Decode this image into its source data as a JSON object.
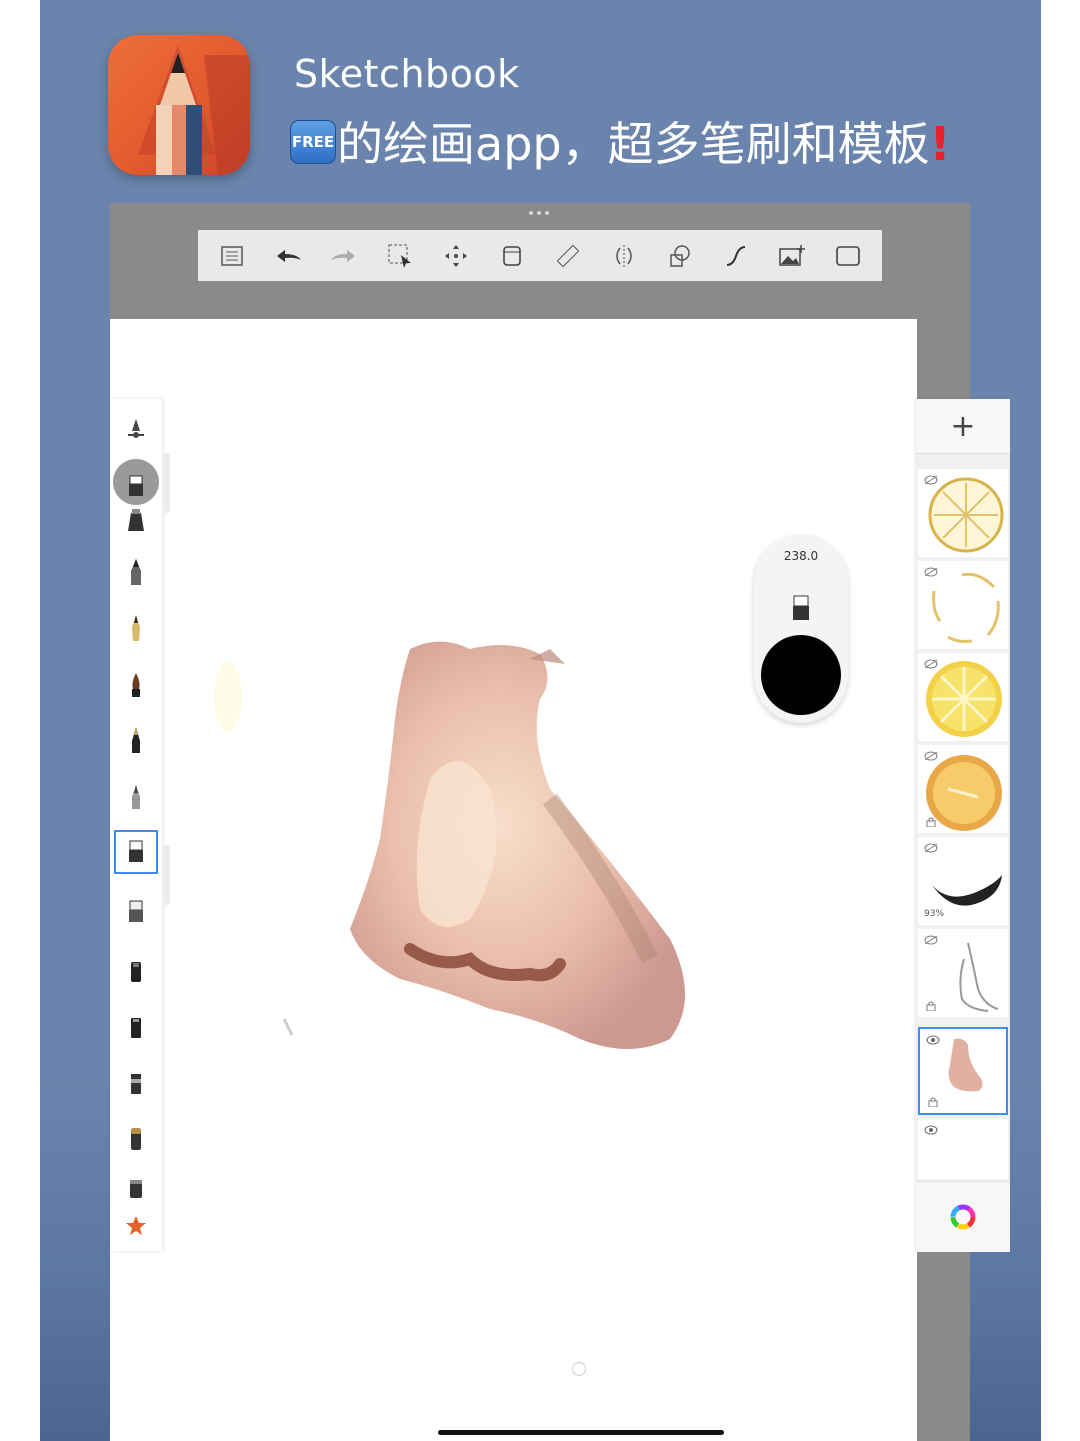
{
  "header": {
    "app_name": "Sketchbook",
    "free_badge": "FREE",
    "headline": "的绘画app，超多笔刷和模板",
    "exclaim": "!"
  },
  "toolbar": {
    "icons": [
      "layers-list-icon",
      "undo-icon",
      "redo-icon",
      "selection-icon",
      "transform-icon",
      "bucket-fill-icon",
      "ruler-icon",
      "symmetry-icon",
      "shapes-icon",
      "stroke-icon",
      "add-image-icon",
      "fullscreen-icon"
    ]
  },
  "brush_puck": {
    "size_value": "238.0",
    "current_color": "#000000"
  },
  "layers": {
    "add_label": "+",
    "items": [
      {
        "name": "layer-lemon-slice-lines",
        "visible": false
      },
      {
        "name": "layer-lemon-slice-sketch",
        "visible": false
      },
      {
        "name": "layer-lemon-slice-color",
        "visible": false
      },
      {
        "name": "layer-lemon-half",
        "visible": false
      },
      {
        "name": "layer-brush-stroke",
        "visible": false,
        "opacity": "93%"
      },
      {
        "name": "layer-figure-sketch",
        "visible": false
      },
      {
        "name": "layer-nose-painting",
        "visible": true,
        "selected": true
      },
      {
        "name": "layer-empty",
        "visible": true
      }
    ]
  },
  "colors": {
    "accent": "#3f8de8",
    "background": "#6a84ad",
    "app_icon": "#e35a2e",
    "exclaim": "#e8202a"
  }
}
